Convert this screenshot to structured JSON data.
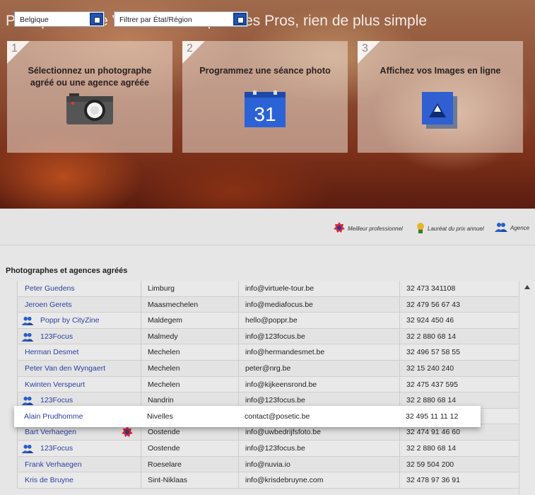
{
  "hero": {
    "title": "Pour profiter de Visite virtuelle pour les Pros, rien de plus simple",
    "steps": [
      {
        "number": "1",
        "title": "Sélectionnez un photographe agréé ou une agence agréée",
        "icon": "camera-icon"
      },
      {
        "number": "2",
        "title": "Programmez une séance photo",
        "icon": "calendar-icon",
        "calendar_day": "31"
      },
      {
        "number": "3",
        "title": "Affichez vos Images en ligne",
        "icon": "photo-icon"
      }
    ]
  },
  "filters": {
    "country": "Belgique",
    "region": "Filtrer par État/Région"
  },
  "legend": {
    "best_pro": "Meilleur professionnel",
    "annual_prize": "Lauréat du prix annuel",
    "agency": "Agence"
  },
  "list": {
    "title": "Photographes et agences agréés",
    "rows": [
      {
        "name": "Peter Guedens",
        "city": "Limburg",
        "email": "info@virtuele-tour.be",
        "phone": "32 473 341108",
        "agency": false
      },
      {
        "name": "Jeroen Gerets",
        "city": "Maasmechelen",
        "email": "info@mediafocus.be",
        "phone": "32 479 56 67 43",
        "agency": false
      },
      {
        "name": "Poppr by CityZine",
        "city": "Maldegem",
        "email": "hello@poppr.be",
        "phone": "32 924 450 46",
        "agency": true
      },
      {
        "name": "123Focus",
        "city": "Malmedy",
        "email": "info@123focus.be",
        "phone": "32 2 880 68 14",
        "agency": true
      },
      {
        "name": "Herman Desmet",
        "city": "Mechelen",
        "email": "info@hermandesmet.be",
        "phone": "32 496 57 58 55",
        "agency": false
      },
      {
        "name": "Peter Van den Wyngaert",
        "city": "Mechelen",
        "email": "peter@nrg.be",
        "phone": "32 15 240 240",
        "agency": false
      },
      {
        "name": "Kwinten Verspeurt",
        "city": "Mechelen",
        "email": "info@kijkeensrond.be",
        "phone": "32 475 437 595",
        "agency": false
      },
      {
        "name": "123Focus",
        "city": "Nandrin",
        "email": "info@123focus.be",
        "phone": "32 2 880 68 14",
        "agency": true
      },
      {
        "name": "Alain Prudhomme",
        "city": "Nivelles",
        "email": "contact@posetic.be",
        "phone": "32 495 11 11 12",
        "agency": false
      },
      {
        "name": "Bart Verhaegen",
        "city": "Oostende",
        "email": "info@uwbedrijfsfoto.be",
        "phone": "32 474 91 46 60",
        "agency": false,
        "best_pro": true
      },
      {
        "name": "123Focus",
        "city": "Oostende",
        "email": "info@123focus.be",
        "phone": "32 2 880 68 14",
        "agency": true
      },
      {
        "name": "Frank Verhaegen",
        "city": "Roeselare",
        "email": "info@nuvia.io",
        "phone": "32 59 504 200",
        "agency": false
      },
      {
        "name": "Kris de Bruyne",
        "city": "Sint-Niklaas",
        "email": "info@krisdebruyne.com",
        "phone": "32 478 97 36 91",
        "agency": false
      }
    ],
    "highlighted_index": 8
  }
}
